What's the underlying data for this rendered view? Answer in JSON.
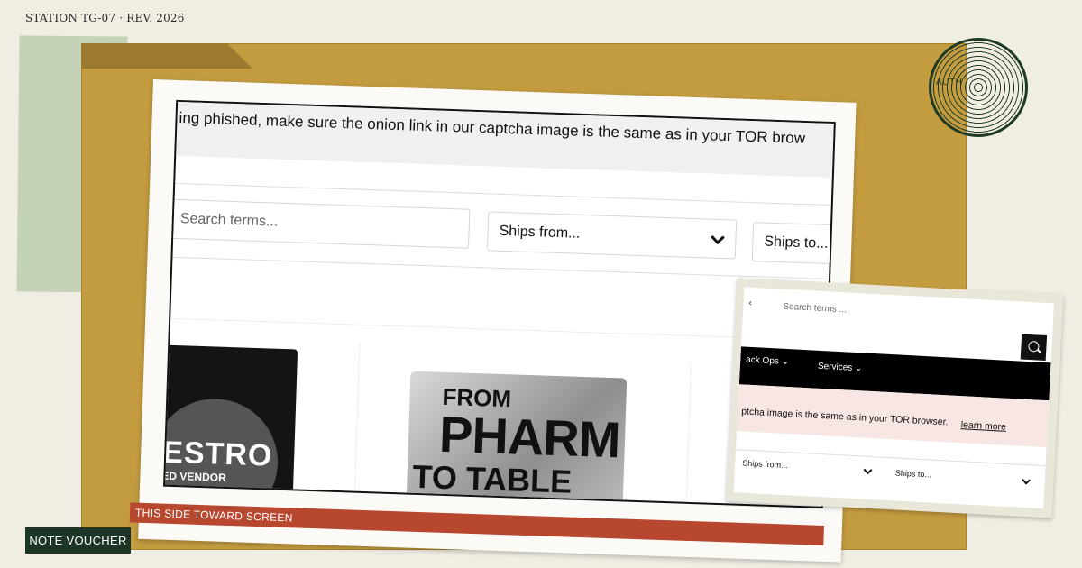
{
  "header": {
    "station_label": "STATION TG-07 · REV. 2026"
  },
  "stamp": {
    "text": "AUTH"
  },
  "main_screenshot": {
    "banner_text": "ing phished, make sure the onion link in our captcha image is the same as in your TOR brow",
    "search_placeholder": "Search terms...",
    "ships_from_label": "Ships from...",
    "ships_to_label": "Ships to...",
    "vendor_card": {
      "title": "ESTRO",
      "subtitle": "ED VENDOR"
    },
    "product_image": {
      "line1": "FROM",
      "line2": "PHARM",
      "line3": "TO TABLE"
    },
    "bottom_band": "THIS SIDE TOWARD SCREEN"
  },
  "small_screenshot": {
    "search_placeholder": "Search terms ...",
    "nav_items": [
      "ack Ops ⌄",
      "Services ⌄"
    ],
    "alert_text": "ptcha image is the same as in your TOR browser.",
    "alert_link": "learn more",
    "ships_from_label": "Ships from...",
    "ships_to_label": "Ships to..."
  },
  "footer": {
    "note_voucher": "NOTE VOUCHER"
  },
  "colors": {
    "board": "#c49c40",
    "tape": "#c4d2b8",
    "stamp": "#1e3a26",
    "band": "#b8472f",
    "voucher": "#1d3527"
  }
}
